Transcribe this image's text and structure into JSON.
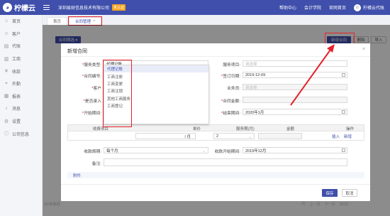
{
  "brand": {
    "name": "柠檬云"
  },
  "header": {
    "company": "深圳易财信息技术有限公司",
    "verify_badge": "未认证",
    "nav": [
      "帮助中心",
      "会计学院",
      "官网首页"
    ],
    "user": "柠檬云代账"
  },
  "sidebar": {
    "items": [
      {
        "label": "首页",
        "icon": "home-icon",
        "glyph": "⌂"
      },
      {
        "label": "客户",
        "icon": "user-icon",
        "glyph": "☺"
      },
      {
        "label": "代账",
        "icon": "book-icon",
        "glyph": "▤"
      },
      {
        "label": "工商",
        "icon": "building-icon",
        "glyph": "▥"
      },
      {
        "label": "收款",
        "icon": "money-icon",
        "glyph": "¥"
      },
      {
        "label": "外勤",
        "icon": "pin-icon",
        "glyph": "⌖"
      },
      {
        "label": "报表",
        "icon": "chart-icon",
        "glyph": "▦"
      },
      {
        "label": "消息",
        "icon": "bell-icon",
        "glyph": "♪"
      },
      {
        "label": "设置",
        "icon": "gear-icon",
        "glyph": "⚙"
      },
      {
        "label": "公司信息",
        "icon": "info-icon",
        "glyph": "ⓘ"
      }
    ]
  },
  "tabs": [
    {
      "label": "首页"
    },
    {
      "label": "合同管理",
      "close": "×"
    }
  ],
  "background": {
    "filter_label": "合同筛选 ▾",
    "new_contract": "新增合同",
    "delete": "删除",
    "import": "导入",
    "total": "共0条数据",
    "pager": [
      "20",
      "上一页",
      "下一页",
      "共0页"
    ]
  },
  "modal": {
    "title": "新增合同",
    "close": "×",
    "service_type": {
      "label": "服务类型:",
      "value": "代理记账"
    },
    "service_item": {
      "label": "服务项目:",
      "placeholder": "请选择"
    },
    "contract_no": {
      "label": "合同编号:"
    },
    "sign_date": {
      "label": "签订日期:",
      "value": "2019-12-09"
    },
    "customer": {
      "label": "客户"
    },
    "salesperson": {
      "label": "业务员:",
      "placeholder": "请选择"
    },
    "is_renewal": {
      "label": "是否录入"
    },
    "amount": {
      "label": "合同金额:"
    },
    "start_period": {
      "label": "开始期间:"
    },
    "end_period": {
      "label": "结束期间:",
      "value": "2020年1月"
    },
    "table": {
      "headers": [
        "收费项目",
        "单价",
        "服务期(月)",
        "金额",
        "操作"
      ],
      "unit": "/ 月",
      "months": "2",
      "insert": "插入",
      "add": "新增"
    },
    "collect_period": {
      "label": "收款周期:",
      "value": "每个月"
    },
    "collect_start": {
      "label": "收款开始期间:",
      "value": "2019年12月"
    },
    "remark": {
      "label": "备注:"
    },
    "attachment": "附件",
    "save": "保存",
    "cancel": "取消"
  },
  "dropdown": {
    "options": [
      "代理记账",
      "工商注册",
      "工商变更",
      "工商注销",
      "其他工商服务",
      "工商登记"
    ]
  },
  "colors": {
    "primary": "#3f4fab",
    "highlight": "#e6212a"
  }
}
